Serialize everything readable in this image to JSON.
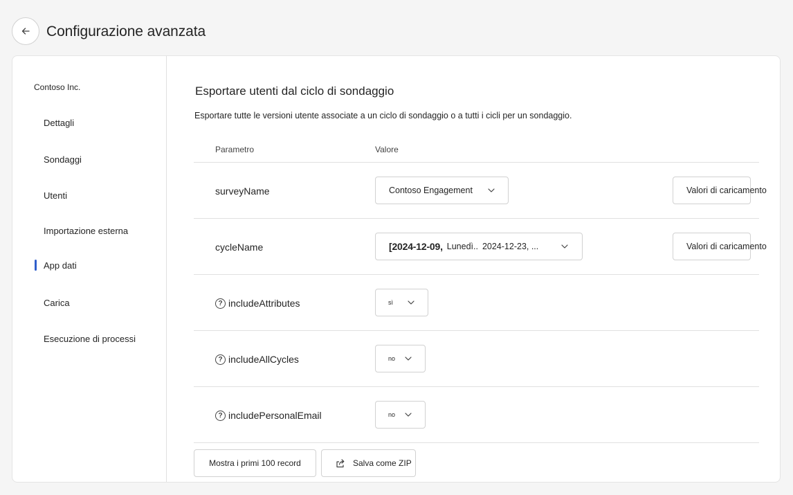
{
  "header": {
    "title": "Configurazione avanzata"
  },
  "sidebar": {
    "org": "Contoso Inc.",
    "items": [
      {
        "label": "Dettagli",
        "active": false
      },
      {
        "label": "Sondaggi",
        "active": false
      },
      {
        "label": "Utenti",
        "active": false
      },
      {
        "label": "Importazione esterna",
        "active": false
      },
      {
        "label": "App dati",
        "active": true
      },
      {
        "label": "Carica",
        "active": false
      },
      {
        "label": "Esecuzione di processi",
        "active": false
      }
    ]
  },
  "main": {
    "title": "Esportare utenti dal ciclo di sondaggio",
    "description": "Esportare tutte le versioni utente associate a un ciclo di sondaggio o a tutti i cicli per un sondaggio.",
    "columns": {
      "param": "Parametro",
      "value": "Valore"
    },
    "params": [
      {
        "name": "surveyName",
        "value": "Contoso Engagement",
        "load_label": "Valori di caricamento"
      },
      {
        "name": "cycleName",
        "value_a": "[2024-12-09,",
        "value_b": "Lunedì..",
        "value_c": "2024-12-23, ...",
        "load_label": "Valori di caricamento"
      },
      {
        "name": "includeAttributes",
        "value": "sì"
      },
      {
        "name": "includeAllCycles",
        "value": "no"
      },
      {
        "name": "includePersonalEmail",
        "value": "no"
      }
    ],
    "actions": {
      "preview": "Mostra i primi 100 record",
      "zip": "Salva come ZIP"
    }
  },
  "colors": {
    "accent": "#2f5ecb"
  }
}
